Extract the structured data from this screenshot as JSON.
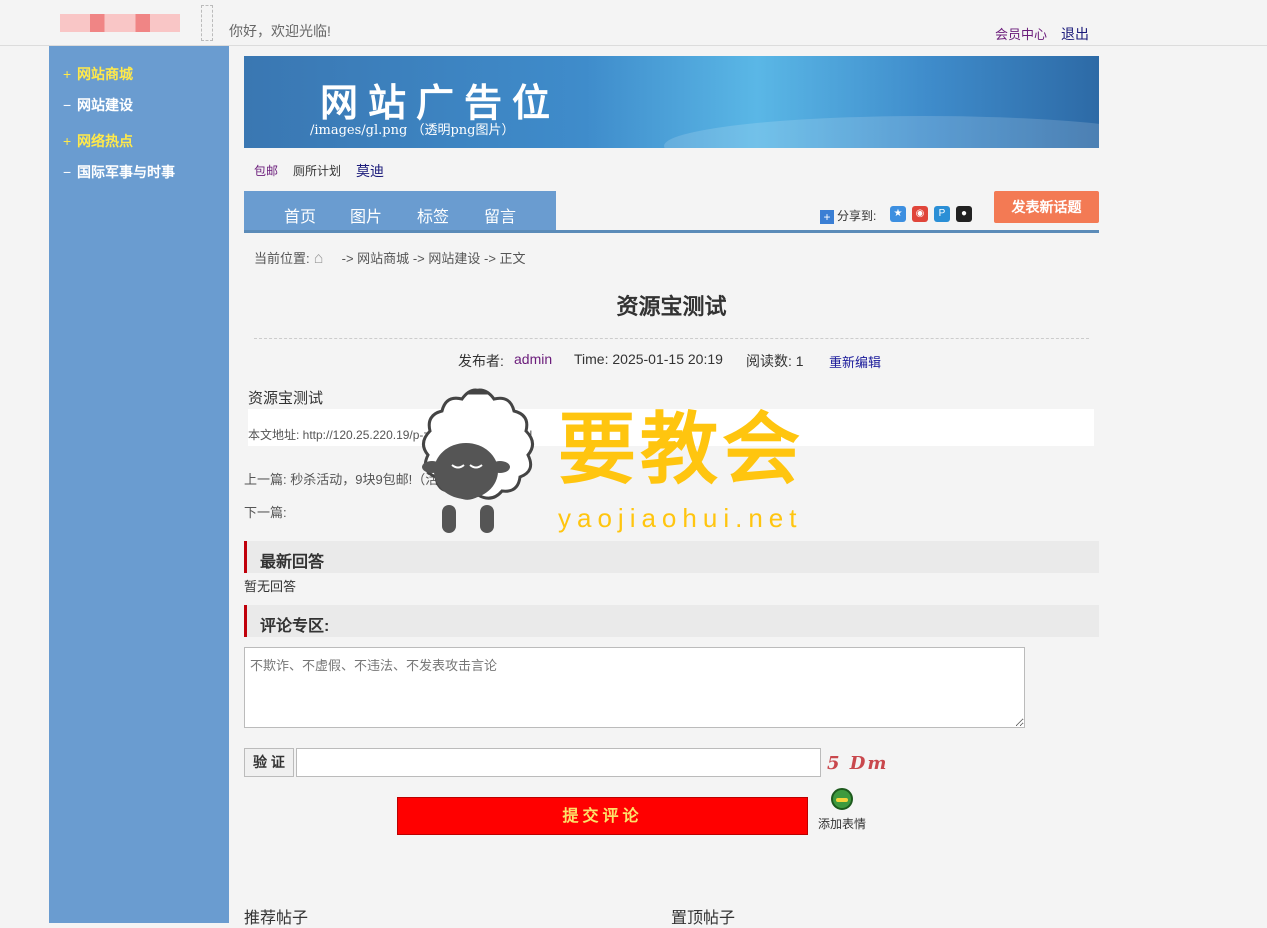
{
  "header": {
    "welcome": "你好，欢迎光临!",
    "member_center": "会员中心",
    "logout": "退出"
  },
  "sidebar": {
    "items": [
      {
        "mark": "+",
        "label": "网站商城"
      },
      {
        "mark": "−",
        "label": "网站建设"
      },
      {
        "mark": "+",
        "label": "网络热点"
      },
      {
        "mark": "−",
        "label": "国际军事与时事"
      }
    ]
  },
  "banner": {
    "title": "网站广告位",
    "subtitle": "/images/gl.png （透明png图片）"
  },
  "quick_links": [
    "包邮",
    "厕所计划",
    "莫迪"
  ],
  "nav": {
    "items": [
      "首页",
      "图片",
      "标签",
      "留言"
    ],
    "share_label": "分享到:",
    "post_button": "发表新话题"
  },
  "breadcrumb": {
    "prefix": "当前位置:",
    "arrow": "->",
    "items": [
      "网站商城",
      "网站建设",
      "正文"
    ]
  },
  "article": {
    "title": "资源宝测试",
    "publisher_label": "发布者:",
    "publisher": "admin",
    "time": "Time: 2025-01-15 20:19",
    "reads": "阅读数: 1",
    "edit": "重新编辑",
    "body": "资源宝测试",
    "url_line": "本文地址:   http://120.25.220.19/p-ziyuanbaoceshi.html",
    "prev": "上一篇:  秒杀活动，9块9包邮!（活动演示页面）",
    "next": "下一篇:"
  },
  "replies": {
    "heading": "最新回答",
    "empty": "暂无回答"
  },
  "comment": {
    "heading": "评论专区:",
    "placeholder": "不欺诈、不虚假、不违法、不发表攻击言论",
    "verify_label": "验 证",
    "captcha": "5 Dm",
    "submit": "提交评论",
    "emoji": "添加表情"
  },
  "bottom": {
    "recommended": "推荐帖子",
    "pinned": "置顶帖子"
  },
  "watermark": {
    "title": "要教会",
    "url": "yaojiaohui.net"
  }
}
